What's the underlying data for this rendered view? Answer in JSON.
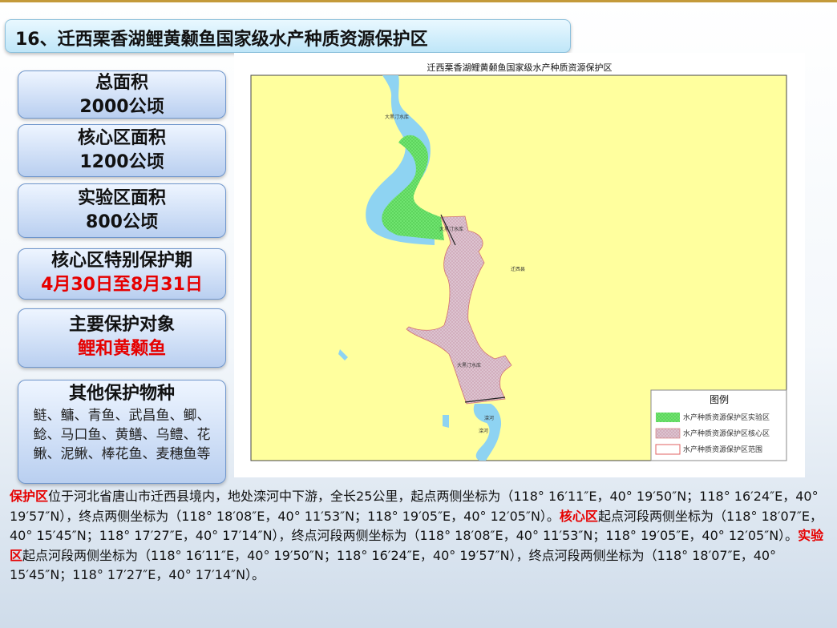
{
  "title": "16、迁西栗香湖鲤黄颡鱼国家级水产种质资源保护区",
  "cards": {
    "total_area": {
      "label": "总面积",
      "value": "2000公顷"
    },
    "core_area": {
      "label": "核心区面积",
      "value": "1200公顷"
    },
    "exp_area": {
      "label": "实验区面积",
      "value": "800公顷"
    },
    "special_period": {
      "label": "核心区特别保护期",
      "value": "4月30日至8月31日"
    },
    "main_species": {
      "label": "主要保护对象",
      "value": "鲤和黄颡鱼"
    },
    "other_species": {
      "label": "其他保护物种",
      "value": "鲢、鳙、青鱼、武昌鱼、鲫、鲶、马口鱼、黄鳝、乌鳢、花鳅、泥鳅、棒花鱼、麦穗鱼等"
    }
  },
  "map": {
    "title": "迁西栗香湖鲤黄颡鱼国家级水产种质资源保护区",
    "labels": {
      "reservoir_top": "大黑汀水库",
      "reservoir_mid": "大黑汀水库",
      "county": "迁西县",
      "reservoir_low": "大黑汀水库",
      "river1": "滦河",
      "river2": "滦河"
    },
    "legend": {
      "title": "图例",
      "items": [
        "水产种质资源保护区实验区",
        "水产种质资源保护区核心区",
        "水产种质资源保护区范围"
      ]
    },
    "colors": {
      "land": "#ffff9e",
      "water": "#8ed3f2",
      "experimental": "#6fe46f",
      "core": "#dcc3d0",
      "boundary": "#e06060"
    }
  },
  "description": {
    "h1": "保护区",
    "t1": "位于河北省唐山市迁西县境内，地处滦河中下游，全长25公里，起点两侧坐标为（118° 16′11″E，40° 19′50″N；118° 16′24″E，40° 19′57″N），终点两侧坐标为（118° 18′08″E，40° 11′53″N；118° 19′05″E，40° 12′05″N）。",
    "h2": "核心区",
    "t2": "起点河段两侧坐标为（118° 18′07″E，40° 15′45″N；118° 17′27″E，40° 17′14″N），终点河段两侧坐标为（118° 18′08″E，40° 11′53″N；118° 19′05″E，40° 12′05″N）。",
    "h3": "实验区",
    "t3": "起点河段两侧坐标为（118° 16′11″E，40° 19′50″N；118° 16′24″E，40° 19′57″N），终点河段两侧坐标为（118° 18′07″E，40° 15′45″N；118° 17′27″E，40° 17′14″N）。"
  }
}
